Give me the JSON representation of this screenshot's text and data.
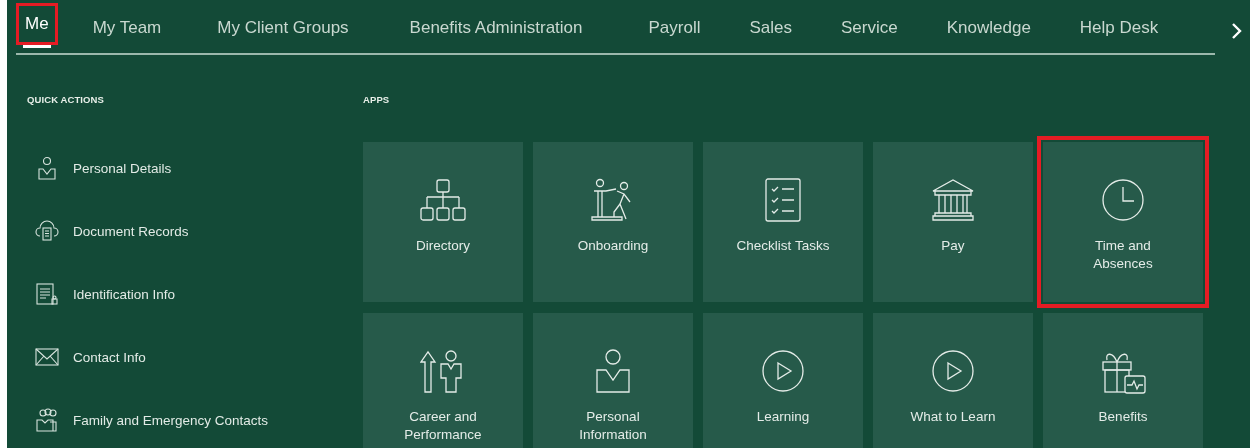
{
  "tabs": [
    {
      "label": "Me",
      "selected": true,
      "highlighted": true
    },
    {
      "label": "My Team",
      "selected": false,
      "highlighted": false
    },
    {
      "label": "My Client Groups",
      "selected": false,
      "highlighted": false
    },
    {
      "label": "Benefits Administration",
      "selected": false,
      "highlighted": false
    },
    {
      "label": "Payroll",
      "selected": false,
      "highlighted": false
    },
    {
      "label": "Sales",
      "selected": false,
      "highlighted": false
    },
    {
      "label": "Service",
      "selected": false,
      "highlighted": false
    },
    {
      "label": "Knowledge",
      "selected": false,
      "highlighted": false
    },
    {
      "label": "Help Desk",
      "selected": false,
      "highlighted": false
    }
  ],
  "quick_actions": {
    "title": "QUICK ACTIONS",
    "items": [
      {
        "label": "Personal Details"
      },
      {
        "label": "Document Records"
      },
      {
        "label": "Identification Info"
      },
      {
        "label": "Contact Info"
      },
      {
        "label": "Family and Emergency Contacts"
      }
    ]
  },
  "apps": {
    "title": "APPS",
    "tiles": [
      {
        "label": "Directory",
        "highlighted": false
      },
      {
        "label": "Onboarding",
        "highlighted": false
      },
      {
        "label": "Checklist Tasks",
        "highlighted": false
      },
      {
        "label": "Pay",
        "highlighted": false
      },
      {
        "label": "Time and Absences",
        "highlighted": true
      },
      {
        "label": "Career and Performance",
        "highlighted": false
      },
      {
        "label": "Personal Information",
        "highlighted": false
      },
      {
        "label": "Learning",
        "highlighted": false
      },
      {
        "label": "What to Learn",
        "highlighted": false
      },
      {
        "label": "Benefits",
        "highlighted": false
      }
    ]
  }
}
